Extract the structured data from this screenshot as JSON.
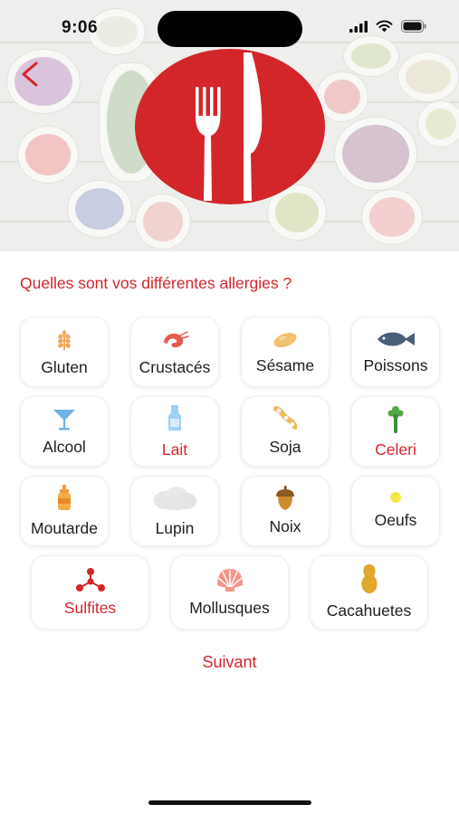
{
  "status_bar": {
    "time": "9:06"
  },
  "header": {
    "back_icon": "chevron-left-icon",
    "logo_icon": "fork-knife-logo-icon"
  },
  "question": "Quelles sont vos différentes allergies ?",
  "allergens": [
    {
      "label": "Gluten",
      "icon": "wheat-icon",
      "selected": false
    },
    {
      "label": "Crustacés",
      "icon": "shrimp-icon",
      "selected": false
    },
    {
      "label": "Sésame",
      "icon": "sesame-icon",
      "selected": false
    },
    {
      "label": "Poissons",
      "icon": "fish-icon",
      "selected": false
    },
    {
      "label": "Alcool",
      "icon": "cocktail-glass-icon",
      "selected": false
    },
    {
      "label": "Lait",
      "icon": "milk-bottle-icon",
      "selected": true
    },
    {
      "label": "Soja",
      "icon": "soy-icon",
      "selected": false
    },
    {
      "label": "Celeri",
      "icon": "celery-icon",
      "selected": true
    },
    {
      "label": "Moutarde",
      "icon": "mustard-bottle-icon",
      "selected": false
    },
    {
      "label": "Lupin",
      "icon": "lupin-icon",
      "selected": false
    },
    {
      "label": "Noix",
      "icon": "acorn-icon",
      "selected": false
    },
    {
      "label": "Oeufs",
      "icon": "egg-icon",
      "selected": false
    },
    {
      "label": "Sulfites",
      "icon": "molecule-icon",
      "selected": true
    },
    {
      "label": "Mollusques",
      "icon": "shell-icon",
      "selected": false
    },
    {
      "label": "Cacahuetes",
      "icon": "peanut-icon",
      "selected": false
    }
  ],
  "next_label": "Suivant",
  "colors": {
    "accent": "#d3262b",
    "text": "#1e1e1e",
    "background": "#ffffff"
  }
}
